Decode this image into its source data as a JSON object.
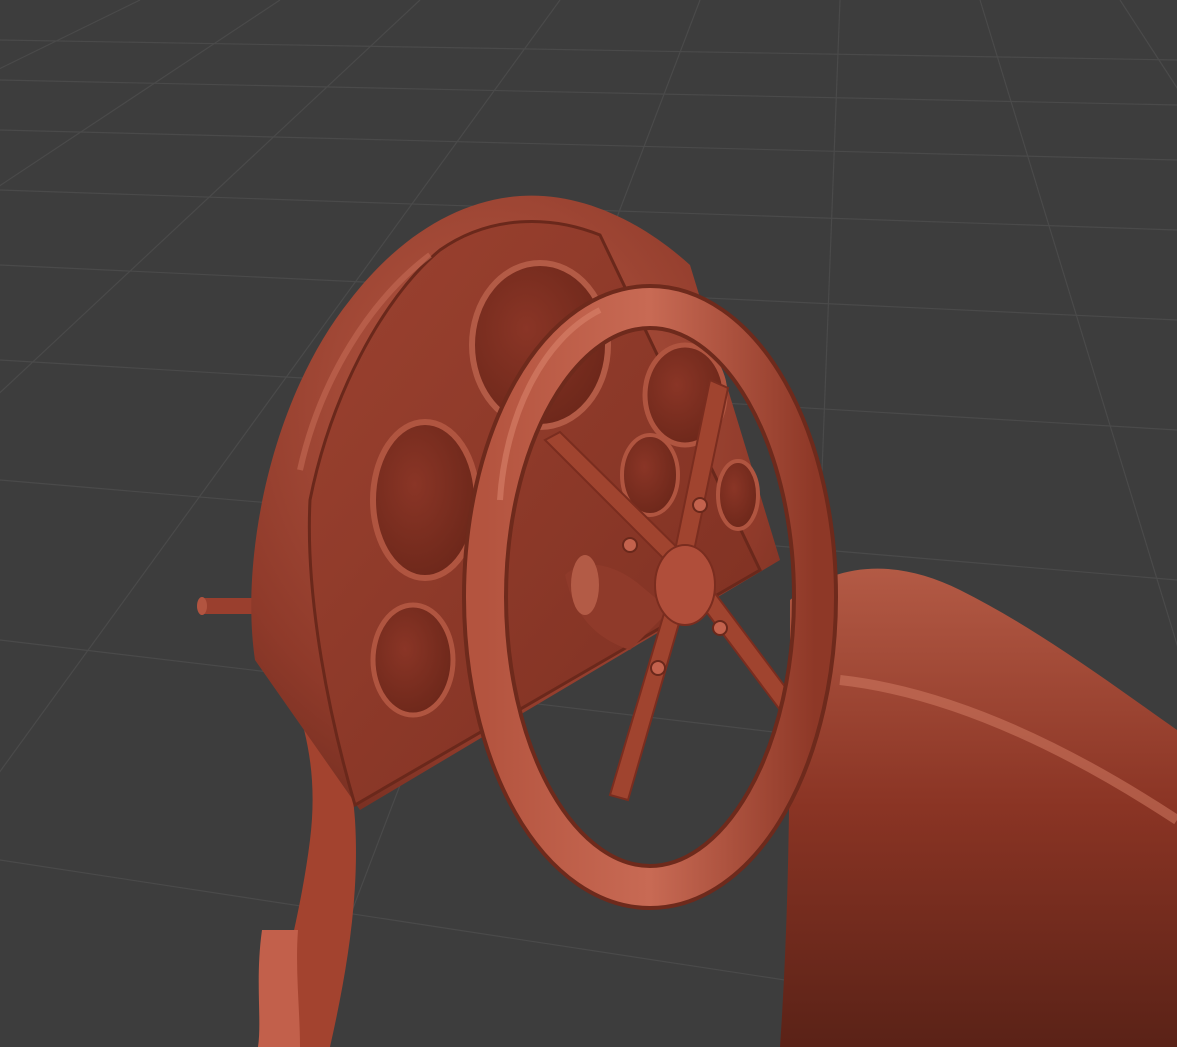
{
  "viewport": {
    "background": "#3d3d3d",
    "grid_color": "#4a4a4a",
    "icon": "3d-viewport"
  },
  "model": {
    "material_color": "#a24a37",
    "highlight_color": "#c8705c",
    "shadow_color": "#5e2419",
    "parts": [
      "dashboard-panel",
      "gauge",
      "steering-wheel",
      "steering-column",
      "car-body",
      "fender-strip",
      "rod"
    ]
  }
}
